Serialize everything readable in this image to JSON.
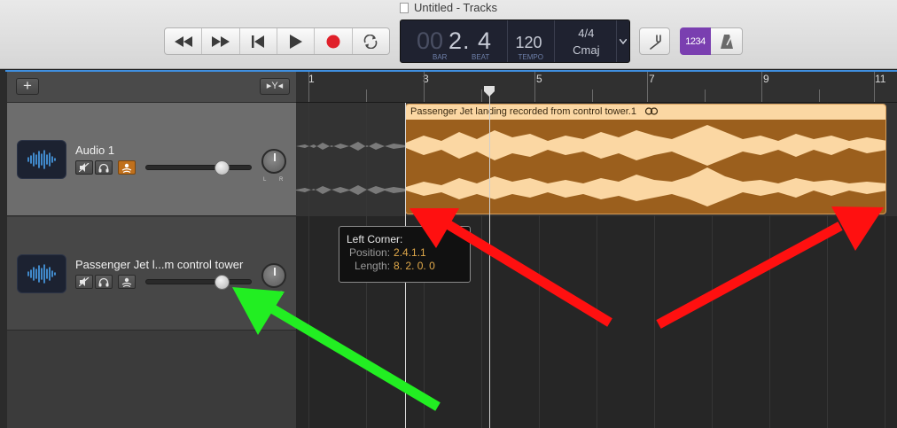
{
  "window": {
    "title": "Untitled - Tracks"
  },
  "lcd": {
    "position_dim": "00",
    "position": "2. 4",
    "bar_label": "BAR",
    "beat_label": "BEAT",
    "tempo": "120",
    "tempo_label": "TEMPO",
    "time_signature": "4/4",
    "key": "Cmaj"
  },
  "toolbar": {
    "count_in": "1234"
  },
  "tracks_header": {
    "add_label": "+",
    "filter_label": "▸Y◂"
  },
  "tracks": [
    {
      "name": "Audio 1",
      "record_enabled": true,
      "volume": 0.7
    },
    {
      "name": "Passenger Jet l...m control tower",
      "record_enabled": false,
      "volume": 0.7
    }
  ],
  "pan": {
    "left": "L",
    "right": "R"
  },
  "ruler": {
    "bars": [
      "1",
      "3",
      "5",
      "7",
      "9",
      "11"
    ]
  },
  "region": {
    "name": "Passenger Jet landing recorded from control tower.1"
  },
  "tooltip": {
    "heading": "Left Corner:",
    "position_label": "Position:",
    "position_value": "2.4.1.1",
    "length_label": "Length:",
    "length_value": "8. 2. 0. 0"
  },
  "colors": {
    "region_body": "#9b5f1d",
    "region_header": "#fbd7a3",
    "record": "#e0202a",
    "count_in": "#7a3fb0",
    "arrow_red": "#ff1010",
    "arrow_green": "#22ee22"
  }
}
